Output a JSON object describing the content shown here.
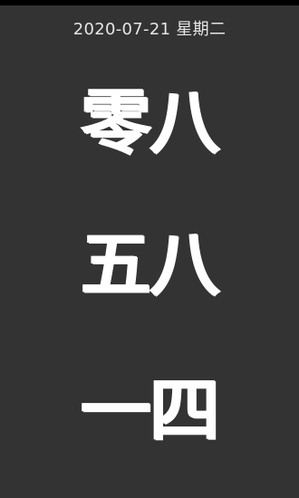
{
  "status_bar": {
    "background": "#000000"
  },
  "header": {
    "date_text": "2020-07-21 星期二"
  },
  "clock": {
    "hour": {
      "tens": "零",
      "ones": "八"
    },
    "minute": {
      "tens": "五",
      "ones": "八"
    },
    "second": {
      "tens": "一",
      "ones": "四"
    }
  },
  "colors": {
    "background": "#333333",
    "digit": "#ffffff",
    "date_text": "#e6e6e6"
  }
}
